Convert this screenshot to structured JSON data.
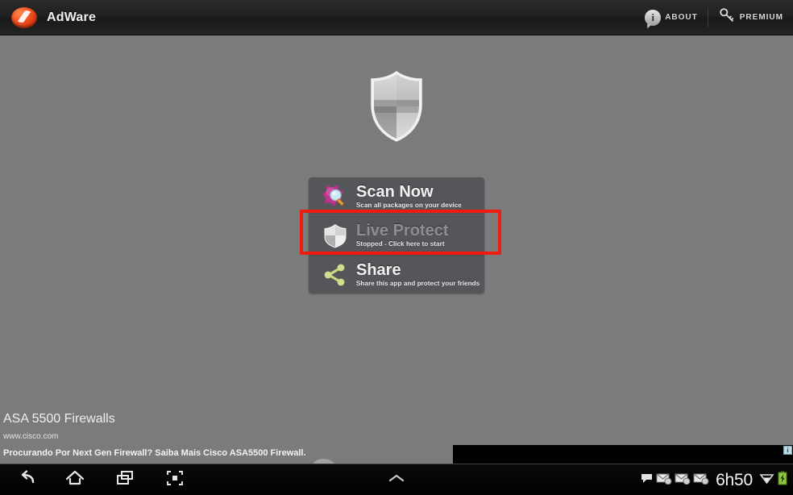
{
  "header": {
    "logo_icon": "adware-oval-logo",
    "title": "AdWare",
    "actions": [
      {
        "label": "ABOUT",
        "icon": "info-bubble-icon"
      },
      {
        "label": "PREMIUM",
        "icon": "key-icon"
      }
    ]
  },
  "hero": {
    "icon": "shield-icon"
  },
  "menu": {
    "items": [
      {
        "id": "scan-now",
        "title": "Scan Now",
        "subtitle": "Scan all packages on your device",
        "icon": "virus-magnifier-icon",
        "dimmed": false,
        "highlighted": true
      },
      {
        "id": "live-protect",
        "title": "Live Protect",
        "subtitle": "Stopped - Click here to start",
        "icon": "shield-icon",
        "dimmed": true,
        "highlighted": false
      },
      {
        "id": "share",
        "title": "Share",
        "subtitle": "Share this app and protect your friends",
        "icon": "share-nodes-icon",
        "dimmed": false,
        "highlighted": false
      }
    ]
  },
  "ad": {
    "headline": "ASA 5500 Firewalls",
    "url": "www.cisco.com",
    "description": "Procurando Por Next Gen Firewall? Saiba Mais Cisco ASA5500 Firewall.",
    "arrow_icon": "chevron-right-icon",
    "banner_adchoices_icon": "adchoices-info-icon",
    "banner_adchoices_label": "i"
  },
  "navbar": {
    "buttons": [
      {
        "id": "back",
        "icon": "back-arrow-icon"
      },
      {
        "id": "home",
        "icon": "home-icon"
      },
      {
        "id": "recents",
        "icon": "recent-apps-icon"
      },
      {
        "id": "screenshot",
        "icon": "screen-capture-icon"
      }
    ],
    "center_icon": "chevron-up-icon",
    "status": {
      "icons": [
        "speech-bubble-icon",
        "mail-icon",
        "mail-icon",
        "mail-icon"
      ],
      "time": "6h50",
      "wifi_icon": "wifi-icon",
      "battery_icon": "battery-charging-icon"
    }
  },
  "colors": {
    "background": "#7b7b7b",
    "header_bar": "#232323",
    "menu_panel": "#55565a",
    "highlight": "#f01b10",
    "accent_logo": "#f4511e",
    "battery_green": "#8ec63f",
    "share_icon": "#ccd67f",
    "virus_icon": "#c0348f"
  }
}
